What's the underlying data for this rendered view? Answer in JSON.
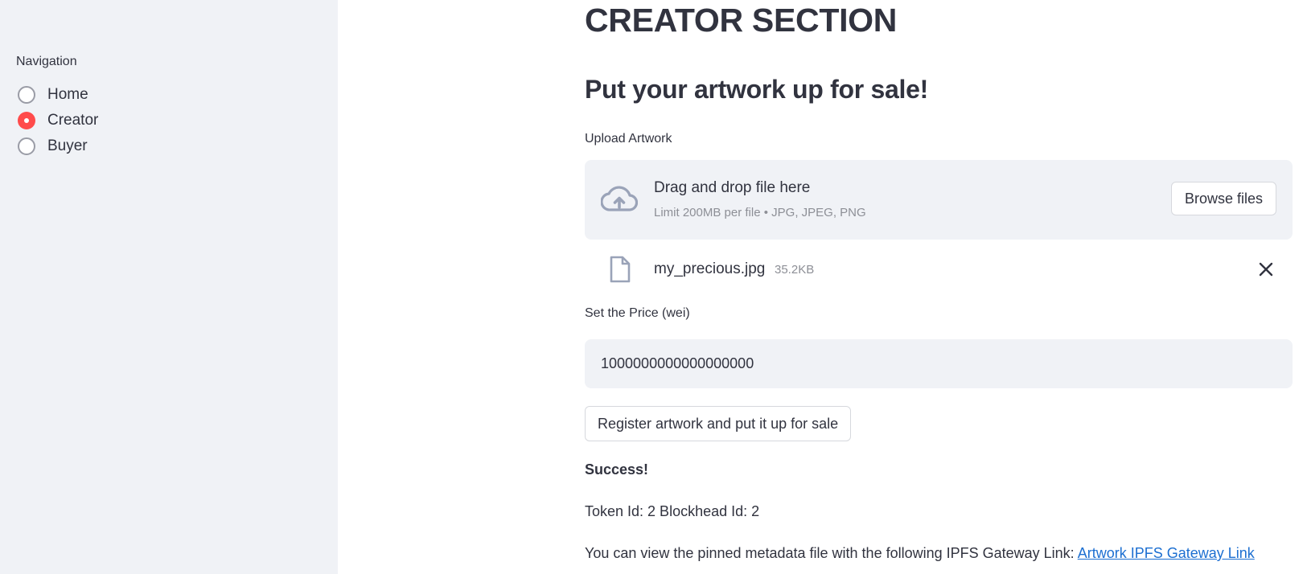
{
  "sidebar": {
    "navigation_label": "Navigation",
    "options": [
      {
        "label": "Home",
        "selected": false
      },
      {
        "label": "Creator",
        "selected": true
      },
      {
        "label": "Buyer",
        "selected": false
      }
    ],
    "accent_color": "#ff4b4b"
  },
  "main": {
    "title": "CREATOR SECTION",
    "subtitle": "Put your artwork up for sale!",
    "upload": {
      "label": "Upload Artwork",
      "dropzone_title": "Drag and drop file here",
      "dropzone_limits": "Limit 200MB per file • JPG, JPEG, PNG",
      "browse_label": "Browse files",
      "file_name": "my_precious.jpg",
      "file_size": "35.2KB"
    },
    "price": {
      "label": "Set the Price (wei)",
      "value": "1000000000000000000"
    },
    "register_label": "Register artwork and put it up for sale",
    "success_text": "Success!",
    "token_info": "Token Id: 2 Blockhead Id: 2",
    "gateway_text": "You can view the pinned metadata file with the following IPFS Gateway Link: ",
    "gateway_link_text": "Artwork IPFS Gateway Link",
    "link_color": "#1c6fd1"
  }
}
